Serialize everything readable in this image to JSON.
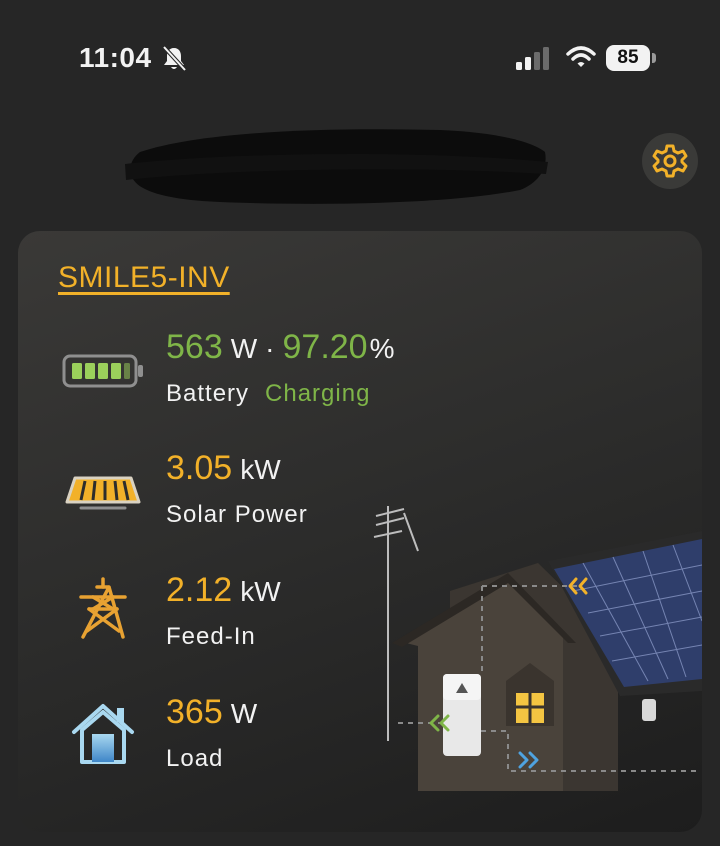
{
  "status_bar": {
    "time": "11:04",
    "battery_level": "85",
    "icons": [
      "bell-slash-icon",
      "signal-icon",
      "wifi-icon",
      "battery-icon"
    ]
  },
  "header": {
    "settings_icon": "gear-icon",
    "accent_color": "#f2b129"
  },
  "device": {
    "name": "SMILE5-INV"
  },
  "metrics": {
    "battery": {
      "power_value": "563",
      "power_unit": "W",
      "separator": "·",
      "soc_value": "97.20",
      "soc_unit": "%",
      "label": "Battery",
      "status": "Charging",
      "icon": "battery-icon",
      "color": "#7fb548"
    },
    "solar": {
      "value": "3.05",
      "unit": "kW",
      "label": "Solar Power",
      "icon": "solar-panel-icon",
      "color": "#f2b129"
    },
    "feed_in": {
      "value": "2.12",
      "unit": "kW",
      "label": "Feed-In",
      "icon": "power-tower-icon",
      "color": "#f2b129"
    },
    "load": {
      "value": "365",
      "unit": "W",
      "label": "Load",
      "icon": "house-icon",
      "color": "#f2b129"
    }
  },
  "scene": {
    "illustration": "house-with-solar-roof-illustration"
  }
}
